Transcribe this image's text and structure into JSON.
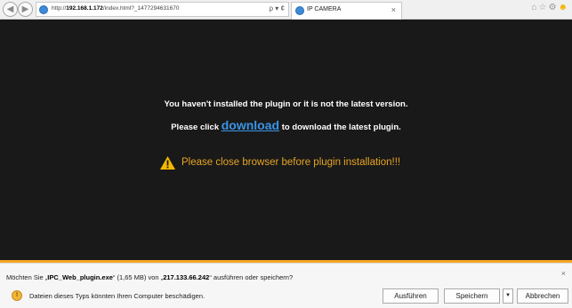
{
  "browser": {
    "url_prefix": "http://",
    "url_host": "192.168.1.172",
    "url_path": "/index.html?_1477294631670",
    "search_glyph": "ρ ▾ ¢",
    "tab_title": "IP CAMERA",
    "tab_close": "×",
    "toolbar_icons": [
      "home-icon",
      "star-icon",
      "gear-icon",
      "smiley-icon"
    ]
  },
  "page": {
    "line1": "You haven't installed the plugin or it is not the latest version.",
    "line2_before": "Please click ",
    "line2_link": "download",
    "line2_after": " to download the latest plugin.",
    "warning": "Please close browser before plugin installation!!!",
    "colors": {
      "background": "#191919",
      "link": "#3a95e6",
      "warning": "#e6a522",
      "divider": "#f5a623"
    }
  },
  "download_bar": {
    "q1": "Möchten Sie „",
    "filename": "IPC_Web_plugin.exe",
    "q2": "“ (1,65 MB) von „",
    "host": "217.133.66.242",
    "q3": "“ ausführen oder speichern?",
    "security_msg": "Dateien dieses Typs könnten Ihren Computer beschädigen.",
    "run_label": "Ausführen",
    "save_label": "Speichern",
    "cancel_label": "Abbrechen",
    "close_glyph": "×"
  }
}
